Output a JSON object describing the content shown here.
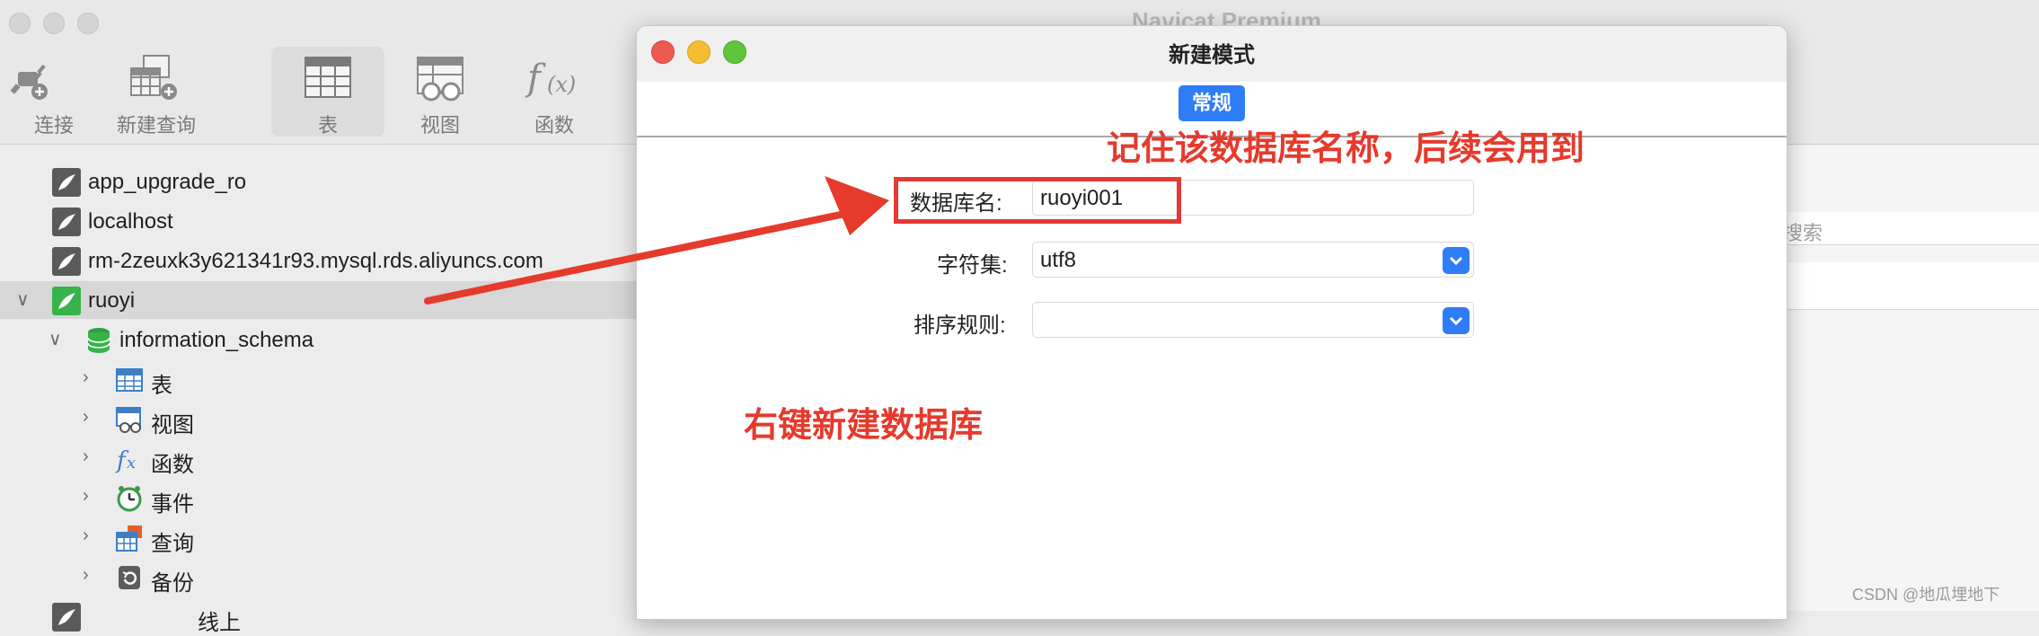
{
  "app": {
    "title": "Navicat Premium"
  },
  "toolbar": {
    "items": [
      {
        "label": "连接",
        "icon": "plug-icon"
      },
      {
        "label": "新建查询",
        "icon": "new-query-icon"
      },
      {
        "label": "表",
        "icon": "table-icon",
        "active": true
      },
      {
        "label": "视图",
        "icon": "view-icon"
      },
      {
        "label": "函数",
        "icon": "function-icon"
      }
    ]
  },
  "sidebar": {
    "connections": [
      {
        "label": "app_upgrade_ro"
      },
      {
        "label": "localhost"
      },
      {
        "label": "rm-2zeuxk3y621341r93.mysql.rds.aliyuncs.com"
      },
      {
        "label": "ruoyi"
      }
    ],
    "database": {
      "label": "information_schema"
    },
    "children": [
      {
        "label": "表",
        "icon": "table-icon"
      },
      {
        "label": "视图",
        "icon": "view-icon"
      },
      {
        "label": "函数",
        "icon": "function-icon"
      },
      {
        "label": "事件",
        "icon": "clock-icon"
      },
      {
        "label": "查询",
        "icon": "query-icon"
      },
      {
        "label": "备份",
        "icon": "backup-icon"
      }
    ],
    "partial_last": "线上"
  },
  "right_panel": {
    "search_placeholder": "搜索"
  },
  "dialog": {
    "title": "新建模式",
    "tab": "常规",
    "fields": {
      "db_name": {
        "label": "数据库名:",
        "value": "ruoyi001"
      },
      "charset": {
        "label": "字符集:",
        "value": "utf8"
      },
      "collation": {
        "label": "排序规则:",
        "value": ""
      }
    }
  },
  "annotations": {
    "remember": "记住该数据库名称，后续会用到",
    "right_click": "右键新建数据库"
  },
  "watermark": "CSDN @地瓜埋地下",
  "colors": {
    "accent": "#2f7df6",
    "annotation": "#e53a2c",
    "selected_conn": "#37b34a"
  }
}
